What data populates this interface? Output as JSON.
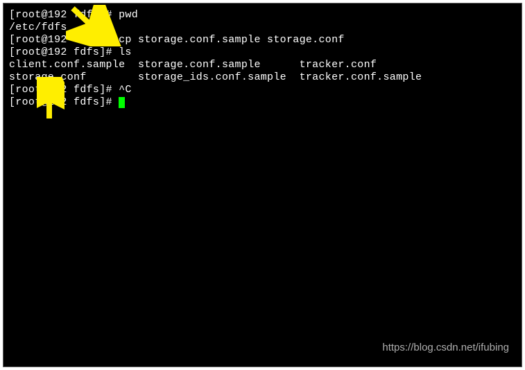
{
  "terminal": {
    "lines": [
      {
        "prompt": "[root@192 fdfs]# ",
        "cmd": "pwd"
      },
      {
        "output": "/etc/fdfs"
      },
      {
        "prompt": "[root@192 fdfs]# ",
        "cmd": "cp storage.conf.sample storage.conf"
      },
      {
        "prompt": "[root@192 fdfs]# ",
        "cmd": "ls"
      },
      {
        "output": "client.conf.sample  storage.conf.sample      tracker.conf"
      },
      {
        "output": "storage.conf        storage_ids.conf.sample  tracker.conf.sample"
      },
      {
        "prompt": "[root@192 fdfs]# ",
        "cmd": "^C"
      },
      {
        "prompt": "[root@192 fdfs]# ",
        "cursor": true
      }
    ]
  },
  "watermark": "https://blog.csdn.net/ifubing",
  "annotations": {
    "arrow1_target": "cp command / fdfs directory",
    "arrow2_target": "storage.conf file"
  }
}
